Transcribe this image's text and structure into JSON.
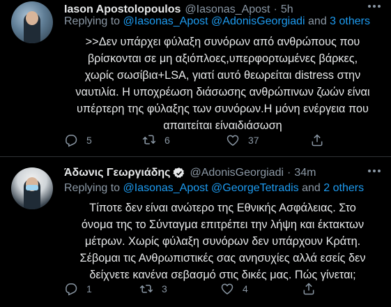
{
  "tweets": [
    {
      "author_name": "Iason Apostolopoulos",
      "handle": "@Iasonas_Apost",
      "separator": "·",
      "time": "5h",
      "reply_prefix": "Replying to ",
      "reply_mentions": "@Iasonas_Apost @AdonisGeorgiadi",
      "reply_and": " and ",
      "reply_others": "3 others",
      "body_lines": [
        ">>Δεν υπάρχει φύλαξη συνόρων από ανθρώπους που",
        "βρίσκονται σε μη αξιόπλοες,υπερφορτωμένες βάρκες,",
        "χωρίς σωσίβια+LSA, γιατί αυτό θεωρείται distress στην",
        "ναυτιλία. Η υποχρέωση διάσωσης ανθρώπινων ζωών είναι",
        "υπέρτερη της φύλαξης των συνόρων.Η μόνη ενέργεια που",
        "απαιτείται είναιδιάσωση"
      ],
      "actions": {
        "replies": "5",
        "retweets": "6",
        "likes": "37"
      },
      "verified": false
    },
    {
      "author_name": "Άδωνις Γεωργιάδης",
      "handle": "@AdonisGeorgiadi",
      "separator": "·",
      "time": "34m",
      "reply_prefix": "Replying to ",
      "reply_mentions": "@Iasonas_Apost @GeorgeTetradis",
      "reply_and": " and ",
      "reply_others": "2 others",
      "body_lines": [
        "Τίποτε δεν είναι ανώτερο της Εθνικής Ασφάλειας. Στο",
        "όνομα της το Σύνταγμα επιτρέπει την λήψη και έκτακτων",
        "μέτρων. Χωρίς φύλαξη συνόρων δεν υπάρχουν Κράτη.",
        "Σέβομαι τις Ανθρωπιστικές σας ανησυχίες αλλά εσείς δεν",
        "δείχνετε κανένα σεβασμό στις δικές μας. Πώς γίνεται;"
      ],
      "actions": {
        "replies": "1",
        "retweets": "3",
        "likes": "4"
      },
      "verified": true
    }
  ],
  "colors": {
    "background": "#000000",
    "text": "#e7e9ea",
    "secondary": "#8b98a5",
    "link": "#1d9bf0",
    "divider": "#2f3336"
  },
  "icons": [
    "reply-icon",
    "retweet-icon",
    "like-icon",
    "share-icon",
    "verified-badge-icon",
    "more-options-icon"
  ]
}
